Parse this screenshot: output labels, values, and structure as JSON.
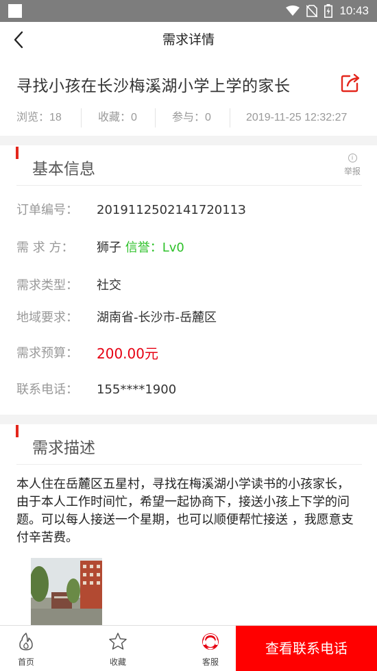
{
  "status_bar": {
    "time": "10:43"
  },
  "header": {
    "title": "需求详情"
  },
  "demand": {
    "title": "寻找小孩在长沙梅溪湖小学上学的家长",
    "views_label": "浏览：18",
    "favorites_label": "收藏：0",
    "participants_label": "参与：0",
    "datetime": "2019-11-25 12:32:27"
  },
  "basic_info": {
    "section_title": "基本信息",
    "report_label": "举报",
    "rows": {
      "order_no": {
        "label": "订单编号：",
        "value": "201911250214172011З"
      },
      "demander": {
        "label": "需 求 方：",
        "name": "狮子",
        "credit": "信誉：Lv0"
      },
      "type": {
        "label": "需求类型：",
        "value": "社交"
      },
      "region": {
        "label": "地域要求：",
        "value": "湖南省-长沙市-岳麓区"
      },
      "budget": {
        "label": "需求预算：",
        "value": "200.00元"
      },
      "phone": {
        "label": "联系电话：",
        "value": "155****1900"
      }
    }
  },
  "description": {
    "section_title": "需求描述",
    "text": "本人住在岳麓区五星村，寻找在梅溪湖小学读书的小孩家长，由于本人工作时间忙，希望一起协商下，接送小孩上下学的问题。可以每人接送一个星期，也可以顺便帮忙接送 ，我愿意支付辛苦费。"
  },
  "bottom_nav": {
    "home_label": "首页",
    "favorite_label": "收藏",
    "service_label": "客服",
    "call_button_label": "查看联系电话"
  },
  "colors": {
    "accent_red": "#e3261c",
    "button_red": "#ff0000",
    "credit_green": "#2ec12a",
    "status_bar": "#7d7d7d"
  },
  "icons": {
    "back": "chevron-left-icon",
    "share": "share-icon",
    "report": "info-icon",
    "home": "home-icon",
    "favorite": "star-icon",
    "service": "headset-icon"
  }
}
